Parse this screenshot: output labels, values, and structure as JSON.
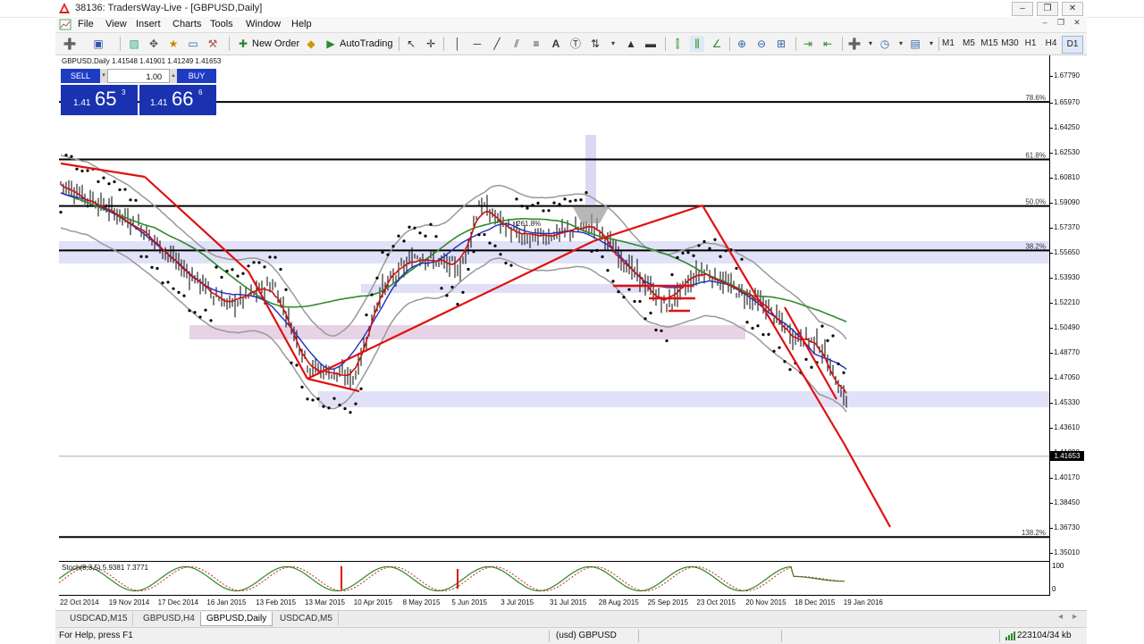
{
  "window": {
    "title": "38136: TradersWay-Live - [GBPUSD,Daily]",
    "minimize": "–",
    "restore": "❐",
    "close": "✕",
    "child_min": "–",
    "child_restore": "❐",
    "child_close": "✕"
  },
  "menu": [
    "File",
    "View",
    "Insert",
    "Charts",
    "Tools",
    "Window",
    "Help"
  ],
  "toolbar": {
    "new_order": "New Order",
    "autotrading": "AutoTrading",
    "text_tool": "A",
    "timeframes": [
      "M1",
      "M5",
      "M15",
      "M30",
      "H1",
      "H4",
      "D1"
    ],
    "active_timeframe": "D1"
  },
  "chart": {
    "symbol_info": "GBPUSD,Daily  1.41548 1.41901 1.41249 1.41653",
    "current_price": "1.41653",
    "price_labels": [
      "1.67790",
      "1.65970",
      "1.64250",
      "1.62530",
      "1.60810",
      "1.59090",
      "1.57370",
      "1.55650",
      "1.53930",
      "1.52210",
      "1.50490",
      "1.48770",
      "1.47050",
      "1.45330",
      "1.43610",
      "1.41890",
      "1.40170",
      "1.38450",
      "1.36730",
      "1.35010"
    ],
    "fib_levels": [
      {
        "label": "78.6%",
        "price": 1.66
      },
      {
        "label": "61.8%",
        "price": 1.6205
      },
      {
        "label": "50.0%",
        "price": 1.5885
      },
      {
        "label": "38.2%",
        "price": 1.558
      },
      {
        "label": "138.2%",
        "price": 1.361
      }
    ],
    "annotation_label": "261.8%",
    "stoch_label": "Stoch(8,3,5) 5.9381 7.3771",
    "stoch_scale": [
      "100",
      "0"
    ],
    "dates": [
      "22 Oct 2014",
      "19 Nov 2014",
      "17 Dec 2014",
      "16 Jan 2015",
      "13 Feb 2015",
      "13 Mar 2015",
      "10 Apr 2015",
      "8 May 2015",
      "5 Jun 2015",
      "3 Jul 2015",
      "31 Jul 2015",
      "28 Aug 2015",
      "25 Sep 2015",
      "23 Oct 2015",
      "20 Nov 2015",
      "18 Dec 2015",
      "19 Jan 2016"
    ],
    "colors": {
      "candles": "#000000",
      "ma_green": "#2e8b2e",
      "ma_blue": "#1f2fbf",
      "ma_red": "#cc1111",
      "bands": "#999999",
      "zone": "#c9c9f2",
      "zone_purple": "#d6b8d6",
      "trend": "#e01010"
    }
  },
  "trade_panel": {
    "sell_label": "SELL",
    "buy_label": "BUY",
    "lot": "1.00",
    "sell_prefix": "1.41",
    "sell_big": "65",
    "sell_sup": "3",
    "buy_prefix": "1.41",
    "buy_big": "66",
    "buy_sup": "6"
  },
  "tabs": [
    "USDCAD,M15",
    "GBPUSD,H4",
    "GBPUSD,Daily",
    "USDCAD,M5"
  ],
  "active_tab": "GBPUSD,Daily",
  "status": {
    "help": "For Help, press F1",
    "profile": "(usd) GBPUSD",
    "traffic": "223104/34 kb"
  }
}
